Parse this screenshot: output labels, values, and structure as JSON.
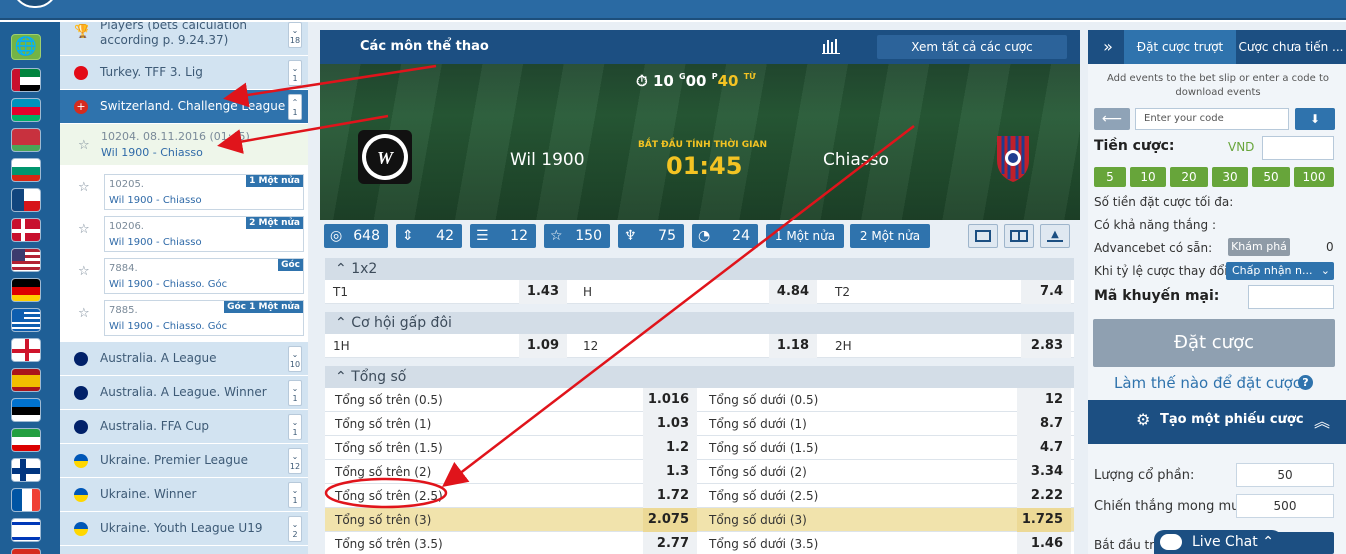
{
  "leagues": {
    "items": [
      {
        "name": "Players (bets calculation according p. 9.24.37)",
        "line2": "according p. 9.24.37)",
        "line1": "Players (bets calculation",
        "count": "18"
      },
      {
        "name": "Turkey. TFF 3. Lig",
        "count": "1"
      },
      {
        "name": "Switzerland. Challenge League",
        "count": "1"
      },
      {
        "name": "Australia. A League",
        "count": "10"
      },
      {
        "name": "Australia. A League. Winner",
        "count": "1"
      },
      {
        "name": "Australia. FFA Cup",
        "count": "1"
      },
      {
        "name": "Ukraine. Premier League",
        "count": "12"
      },
      {
        "name": "Ukraine. Winner",
        "count": "1"
      },
      {
        "name": "Ukraine. Youth League U19",
        "count": "2"
      }
    ],
    "event": {
      "id_time": "10204. 08.11.2016 (01:45)",
      "match": "Wil 1900 - Chiasso"
    },
    "subevents": [
      {
        "id": "10205.",
        "match": "Wil 1900 - Chiasso",
        "tag": "1 Một nửa"
      },
      {
        "id": "10206.",
        "match": "Wil 1900 - Chiasso",
        "tag": "2 Một nửa"
      },
      {
        "id": "7884.",
        "match": "Wil 1900 - Chiasso. Góc",
        "tag": "Góc"
      },
      {
        "id": "7885.",
        "match": "Wil 1900 - Chiasso. Góc",
        "tag": "Góc 1 Một nửa"
      }
    ]
  },
  "hero": {
    "title": "Các môn thể thao",
    "view_all": "Xem tất cả các cược",
    "timer": {
      "hours": "10",
      "g": "G",
      "mins": "00",
      "p": "P",
      "secs": "40",
      "s": "TỪ"
    },
    "home": "Wil 1900",
    "away": "Chiasso",
    "start_label": "BẮT ĐẦU TÍNH THỜI GIAN",
    "start_time": "01:45"
  },
  "stats": [
    {
      "icon": "target-icon",
      "glyph": "◎",
      "value": "648"
    },
    {
      "icon": "updown-icon",
      "glyph": "⇕",
      "value": "42"
    },
    {
      "icon": "bars-icon",
      "glyph": "☰",
      "value": "12"
    },
    {
      "icon": "star-icon",
      "glyph": "☆",
      "value": "150"
    },
    {
      "icon": "trophy-icon",
      "glyph": "♆",
      "value": "75"
    },
    {
      "icon": "clock-icon",
      "glyph": "◔",
      "value": "24"
    }
  ],
  "halves": [
    "1 Một nửa",
    "2 Một nửa"
  ],
  "markets": {
    "m1x2": {
      "title": "1x2",
      "cells": [
        {
          "label": "T1",
          "odds": "1.43"
        },
        {
          "label": "H",
          "odds": "4.84"
        },
        {
          "label": "T2",
          "odds": "7.4"
        }
      ]
    },
    "double": {
      "title": "Cơ hội gấp đôi",
      "cells": [
        {
          "label": "1H",
          "odds": "1.09"
        },
        {
          "label": "12",
          "odds": "1.18"
        },
        {
          "label": "2H",
          "odds": "2.83"
        }
      ]
    },
    "totals": {
      "title": "Tổng số",
      "rows": [
        {
          "over": "Tổng số trên (0.5)",
          "over_odds": "1.016",
          "under": "Tổng số dưới (0.5)",
          "under_odds": "12"
        },
        {
          "over": "Tổng số trên (1)",
          "over_odds": "1.03",
          "under": "Tổng số dưới (1)",
          "under_odds": "8.7"
        },
        {
          "over": "Tổng số trên (1.5)",
          "over_odds": "1.2",
          "under": "Tổng số dưới (1.5)",
          "under_odds": "4.7"
        },
        {
          "over": "Tổng số trên (2)",
          "over_odds": "1.3",
          "under": "Tổng số dưới (2)",
          "under_odds": "3.34"
        },
        {
          "over": "Tổng số trên (2.5)",
          "over_odds": "1.72",
          "under": "Tổng số dưới (2.5)",
          "under_odds": "2.22"
        },
        {
          "over": "Tổng số trên (3)",
          "over_odds": "2.075",
          "under": "Tổng số dưới (3)",
          "under_odds": "1.725"
        },
        {
          "over": "Tổng số trên (3.5)",
          "over_odds": "2.77",
          "under": "Tổng số dưới (3.5)",
          "under_odds": "1.46"
        }
      ]
    }
  },
  "slip": {
    "tab_slip": "Đặt cược trượt",
    "tab_pending": "Cược chưa tiến ...",
    "info": "Add events to the bet slip or enter a code to download events",
    "code_placeholder": "Enter your code",
    "stake_label": "Tiền cược:",
    "currency": "VND",
    "quick": [
      "5",
      "10",
      "20",
      "30",
      "50",
      "100"
    ],
    "max_label": "Số tiền đặt cược tối đa:",
    "win_label": "Có khả năng thắng :",
    "adv_label": "Advancebet có sẵn:",
    "explore": "Khám phá",
    "adv_value": "0",
    "odds_change_label": "Khi tỷ lệ cược thay đổi:",
    "accept": "Chấp nhận n...",
    "promo_label": "Mã khuyến mại:",
    "place": "Đặt cược",
    "howto": "Làm thế nào để đặt cược",
    "create": "Tạo một phiếu cược",
    "shares_label": "Lượng cổ phần:",
    "shares_value": "50",
    "desired_label": "Chiến thắng mong muốn:",
    "desired_value": "500",
    "start_label": "Bắt đầu trọ"
  },
  "chat": {
    "label": "Live Chat"
  },
  "colors": {
    "header": "#1c4f82",
    "accent": "#2f73ad",
    "green": "#67a53a",
    "highlight": "#f1e3ac",
    "arrow": "#e0141b"
  }
}
